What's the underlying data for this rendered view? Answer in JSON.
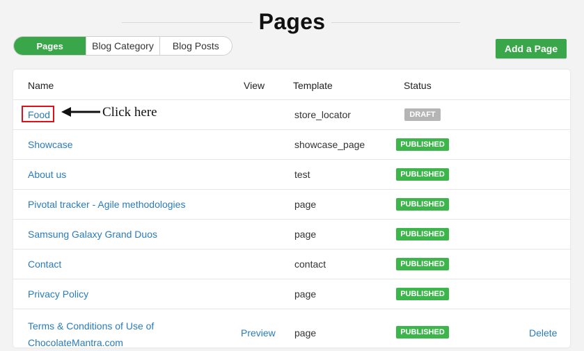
{
  "header": {
    "title": "Pages"
  },
  "tabs": [
    {
      "label": "Pages",
      "active": true
    },
    {
      "label": "Blog Category",
      "active": false
    },
    {
      "label": "Blog Posts",
      "active": false
    }
  ],
  "toolbar": {
    "add_label": "Add a Page"
  },
  "table": {
    "columns": {
      "name": "Name",
      "view": "View",
      "template": "Template",
      "status": "Status"
    },
    "rows": [
      {
        "name": "Food",
        "template": "store_locator",
        "status": "DRAFT"
      },
      {
        "name": "Showcase",
        "template": "showcase_page",
        "status": "PUBLISHED"
      },
      {
        "name": "About us",
        "template": "test",
        "status": "PUBLISHED"
      },
      {
        "name": "Pivotal tracker - Agile methodologies",
        "template": "page",
        "status": "PUBLISHED"
      },
      {
        "name": "Samsung Galaxy Grand Duos",
        "template": "page",
        "status": "PUBLISHED"
      },
      {
        "name": "Contact",
        "template": "contact",
        "status": "PUBLISHED"
      },
      {
        "name": "Privacy Policy",
        "template": "page",
        "status": "PUBLISHED"
      },
      {
        "name_line1": "Terms & Conditions of Use of",
        "name_line2": "ChocolateMantra.com",
        "view": "Preview",
        "template": "page",
        "status": "PUBLISHED",
        "action": "Delete"
      }
    ]
  },
  "annotation": {
    "text": "Click here"
  },
  "colors": {
    "accent": "#3aa64a",
    "link": "#2a7bbd",
    "published": "#3cb54a",
    "draft": "#b5b5b5",
    "highlight": "#e0101b"
  }
}
